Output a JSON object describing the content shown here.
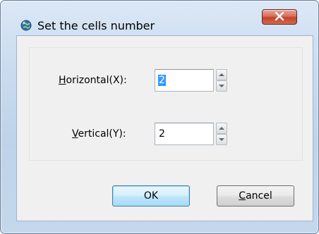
{
  "window": {
    "title": "Set the cells number",
    "icon": "globe-icon",
    "close_icon": "close-icon"
  },
  "fields": {
    "horizontal": {
      "label_mnemonic": "H",
      "label_rest": "orizontal(X):",
      "value": "2"
    },
    "vertical": {
      "label_mnemonic": "V",
      "label_rest": "ertical(Y):",
      "value": "2"
    }
  },
  "buttons": {
    "ok_label": "OK",
    "cancel_mnemonic": "C",
    "cancel_rest": "ancel"
  },
  "colors": {
    "selection": "#3399ff",
    "close_button": "#c3432d",
    "default_button_border": "#3c7fb1"
  }
}
